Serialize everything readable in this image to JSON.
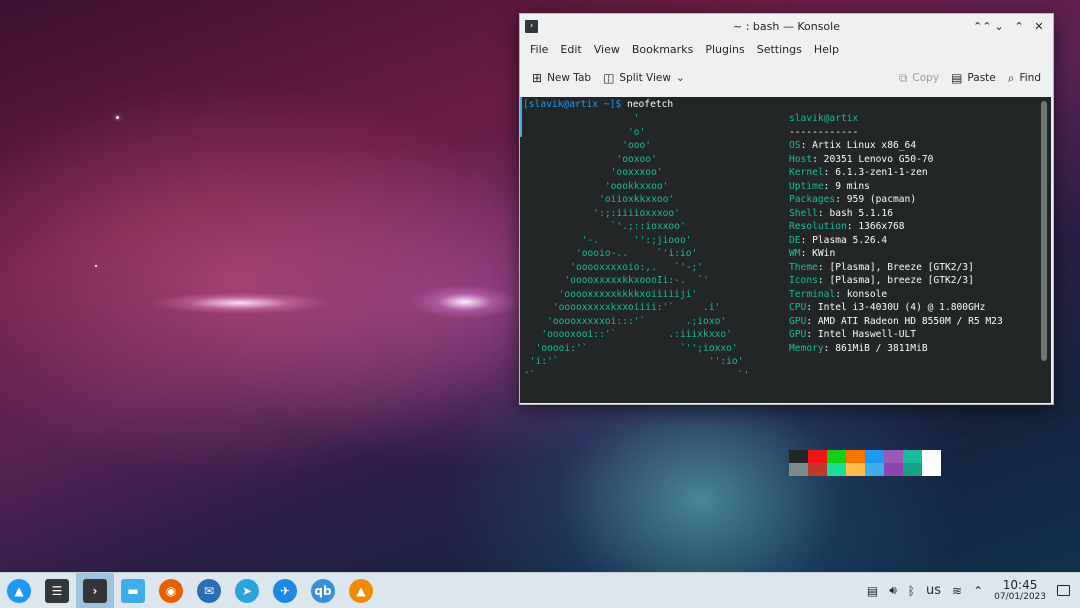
{
  "window": {
    "title": "~ : bash — Konsole",
    "controls": [
      "⌃⌃",
      "⌄",
      "⌃",
      "✕"
    ]
  },
  "menubar": [
    "File",
    "Edit",
    "View",
    "Bookmarks",
    "Plugins",
    "Settings",
    "Help"
  ],
  "toolbar": {
    "new_tab": "New Tab",
    "split_view": "Split View",
    "copy": "Copy",
    "paste": "Paste",
    "find": "Find"
  },
  "terminal": {
    "prompt_user": "[slavik@artix ~]$",
    "command": " neofetch",
    "ascii_art": "                   '\n                  'o'\n                 'ooo'\n                'ooxoo'\n               'ooxxxoo'\n              'oookkxxoo'\n             'oiioxkkxxoo'\n            ':;:iiiioxxxoo'\n               `'.;::ioxxoo'\n          '-.      '':;jiooo'\n         'oooio-..     `'i:io'\n        'ooooxxxxoio:,.   `'-;'\n       'ooooxxxxxkkxoooIi:-.  `'\n      'ooooxxxxxkkkkxoiiiiiji'\n     'ooooxxxxxkxxoiiii:'`     .i'\n    'ooooxxxxxoi:::'`       .;ioxo'\n   'ooooxooi::'`         .:iiixkxxo'\n  'ooooi:'`                `'';ioxxo'\n 'i:'`                          '':io'\n'`                                   `'",
    "user_host": "slavik@artix",
    "separator": "------------",
    "info": [
      {
        "k": "OS",
        "v": "Artix Linux x86_64"
      },
      {
        "k": "Host",
        "v": "20351 Lenovo G50-70"
      },
      {
        "k": "Kernel",
        "v": "6.1.3-zen1-1-zen"
      },
      {
        "k": "Uptime",
        "v": "9 mins"
      },
      {
        "k": "Packages",
        "v": "959 (pacman)"
      },
      {
        "k": "Shell",
        "v": "bash 5.1.16"
      },
      {
        "k": "Resolution",
        "v": "1366x768"
      },
      {
        "k": "DE",
        "v": "Plasma 5.26.4"
      },
      {
        "k": "WM",
        "v": "KWin"
      },
      {
        "k": "Theme",
        "v": "[Plasma], Breeze [GTK2/3]"
      },
      {
        "k": "Icons",
        "v": "[Plasma], breeze [GTK2/3]"
      },
      {
        "k": "Terminal",
        "v": "konsole"
      },
      {
        "k": "CPU",
        "v": "Intel i3-4030U (4) @ 1.800GHz"
      },
      {
        "k": "GPU",
        "v": "AMD ATI Radeon HD 8550M / R5 M23"
      },
      {
        "k": "GPU",
        "v": "Intel Haswell-ULT"
      },
      {
        "k": "Memory",
        "v": "861MiB / 3811MiB"
      }
    ],
    "colors_top": [
      "#232627",
      "#ed1515",
      "#11d116",
      "#f67400",
      "#1d99f3",
      "#9b59b6",
      "#1abc9c",
      "#fcfcfc"
    ],
    "colors_bottom": [
      "#7f8c8d",
      "#c0392b",
      "#1cdc9a",
      "#fdbc4b",
      "#3daee9",
      "#8e44ad",
      "#16a085",
      "#ffffff"
    ]
  },
  "taskbar": {
    "apps": [
      {
        "name": "application-launcher-icon",
        "glyph": "▲",
        "color": "#1d99f3"
      },
      {
        "name": "system-settings-icon",
        "glyph": "☰",
        "color": "#31363b"
      },
      {
        "name": "konsole-icon",
        "glyph": "›",
        "color": "#31363b"
      },
      {
        "name": "dolphin-icon",
        "glyph": "▬",
        "color": "#3daee9"
      },
      {
        "name": "firefox-icon",
        "glyph": "◉",
        "color": "#e66000"
      },
      {
        "name": "thunderbird-icon",
        "glyph": "✉",
        "color": "#2a6fb5"
      },
      {
        "name": "telegram-icon",
        "glyph": "➤",
        "color": "#2aa3df"
      },
      {
        "name": "network-app-icon",
        "glyph": "✈",
        "color": "#1e88e5"
      },
      {
        "name": "qbittorrent-icon",
        "glyph": "qb",
        "color": "#3a8fd9"
      },
      {
        "name": "vlc-icon",
        "glyph": "▲",
        "color": "#f08a00"
      }
    ],
    "keyboard_layout": "us",
    "time": "10:45",
    "date": "07/01/2023"
  }
}
